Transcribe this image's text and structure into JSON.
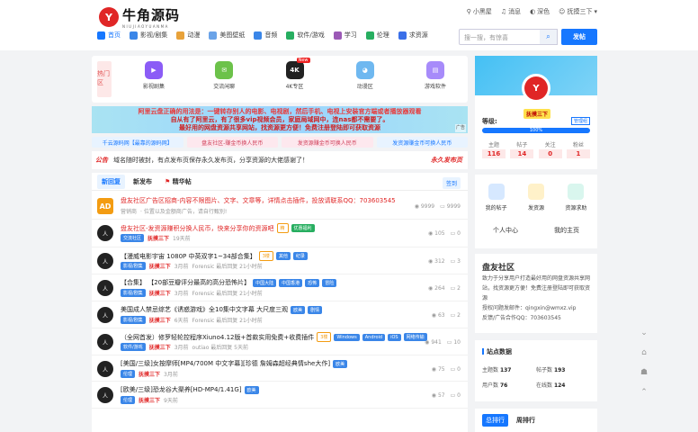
{
  "logo": {
    "mark": "Y",
    "name": "牛角源码",
    "sub": "NIUJIAOYUANMA"
  },
  "top_right": {
    "user1": "小黑屋",
    "messages": "消息",
    "theme": "深色",
    "user2": "抚摸三下"
  },
  "nav": [
    {
      "label": "首页",
      "color": "#1677ff"
    },
    {
      "label": "影视/剧集",
      "color": "#3a86e8"
    },
    {
      "label": "动漫",
      "color": "#e8a23a"
    },
    {
      "label": "美图壁纸",
      "color": "#6aa3e8"
    },
    {
      "label": "音频",
      "color": "#3a86e8"
    },
    {
      "label": "软件/游戏",
      "color": "#27ae60"
    },
    {
      "label": "学习",
      "color": "#9b59b6"
    },
    {
      "label": "伦理",
      "color": "#27ae60"
    },
    {
      "label": "求资源",
      "color": "#3a6fe8"
    }
  ],
  "search": {
    "placeholder": "搜一搜，有惊喜",
    "button": "⌕"
  },
  "post_button": "发帖",
  "hot": {
    "tag": "热门区",
    "items": [
      {
        "label": "影视剧集",
        "icon": "▶",
        "color": "#8b5cf6"
      },
      {
        "label": "交流闲聊",
        "icon": "✉",
        "color": "#6cc24a"
      },
      {
        "label": "4K专区",
        "icon": "4K",
        "color": "#222222",
        "badge": "New"
      },
      {
        "label": "动漫区",
        "icon": "◕",
        "color": "#6fb8f0"
      },
      {
        "label": "游戏软件",
        "icon": "▤",
        "color": "#a78bfa"
      }
    ]
  },
  "ad_banner": {
    "line1": "阿里云盘正确的用法是：一键转存别人的电影、电视剧，然后手机、电视上安装官方端或者播放器观看",
    "line2": "自从有了阿里云，有了很多vip视频会员，家庭局域网中，连nas都不需要了。",
    "line3": "最好用的网盘资源共享网站，找资源更方便！免费注册登陆即可获取资源",
    "label": "广告"
  },
  "links": [
    "千云源码网【最靠的源码网】",
    "盘友社区-赚金币换人民币",
    "发资源赚金币可换人民币",
    "发资源赚金币可换人民币"
  ],
  "notice": {
    "tag": "公告",
    "text": "域名随时被封，有点发布页保存永久发布页，分享资源的大佬感谢了！",
    "right": "永久发布页"
  },
  "tabs": [
    "新回复",
    "新发布",
    "精华帖"
  ],
  "sign": "签到",
  "posts": [
    {
      "avatar": "AD",
      "title": "盘友社区广告区招商-内容不限图片、文字、文章等，详情点击插件，投放请联系QQ：703603545",
      "meta_user": "营销商",
      "meta_text": "· 位置以及金额商广告，请自行甄别!",
      "views": "9999",
      "comments": "9999",
      "red": true
    },
    {
      "avatar": "人",
      "title": "盘友社区-发资源赚积分换人民币，快来分享你的资源吧",
      "chips": [
        {
          "t": "精",
          "k": "o"
        },
        {
          "t": "优惠福利",
          "k": "g"
        }
      ],
      "cat": "交流社区",
      "user": "抚摸三下",
      "time": "19天前",
      "views": "105",
      "comments": "0",
      "red": true
    },
    {
      "avatar": "人",
      "title": "【漫威电影宇宙 1080P 中英双字1~34部合集】",
      "chips": [
        {
          "t": "3楼",
          "k": "o"
        },
        {
          "t": "其他",
          "k": ""
        },
        {
          "t": "纪录",
          "k": ""
        }
      ],
      "cat": "影视/剧集",
      "user": "抚摸三下",
      "time": "3月前",
      "reply": "Forensic 最后回复 21小时前",
      "views": "312",
      "comments": "3"
    },
    {
      "avatar": "人",
      "title": "【合集】 【20部豆瓣评分最高的高分恐怖片】",
      "chips": [
        {
          "t": "中国大陆",
          "k": ""
        },
        {
          "t": "中国香港",
          "k": ""
        },
        {
          "t": "恐怖",
          "k": ""
        },
        {
          "t": "冒险",
          "k": ""
        }
      ],
      "cat": "影视/剧集",
      "user": "抚摸三下",
      "time": "3月前",
      "reply": "Forensic 最后回复 21小时前",
      "views": "264",
      "comments": "2"
    },
    {
      "avatar": "人",
      "title": "美国成人禁忌综艺《诱惑游戏》全10集中文字幕 大尺度三观",
      "chips": [
        {
          "t": "欧美",
          "k": ""
        },
        {
          "t": "剧情",
          "k": ""
        }
      ],
      "cat": "影视/剧集",
      "user": "抚摸三下",
      "time": "6天前",
      "reply": "Forensic 最后回复 21小时前",
      "views": "63",
      "comments": "2"
    },
    {
      "avatar": "人",
      "title": "（全网首发）修罗轻轮控程序Xiuno4.12版+首款实用免费+收费插件",
      "chips": [
        {
          "t": "3楼",
          "k": "o"
        },
        {
          "t": "Windows",
          "k": ""
        },
        {
          "t": "Android",
          "k": ""
        },
        {
          "t": "iOS",
          "k": ""
        },
        {
          "t": "网络传输",
          "k": ""
        }
      ],
      "cat": "软件/游戏",
      "user": "抚摸三下",
      "time": "3月前",
      "reply": "outiao 最后回复 5天前",
      "views": "941",
      "comments": "10"
    },
    {
      "avatar": "人",
      "title": "[美国/三级]女按摩师[MP4/700M 中文字幕][珍德 詹姆森超经典情she大作]",
      "chips": [
        {
          "t": "欧美",
          "k": ""
        }
      ],
      "cat": "伦理",
      "user": "抚摸三下",
      "time": "3月前",
      "views": "75",
      "comments": "0"
    },
    {
      "avatar": "人",
      "title": "[欧美/三级]恐龙谷大渠养[HD-MP4/1.41G]",
      "chips": [
        {
          "t": "欧美",
          "k": ""
        }
      ],
      "cat": "伦理",
      "user": "抚摸三下",
      "time": "9天前",
      "views": "57",
      "comments": "0"
    }
  ],
  "profile": {
    "name": "抚摸三下",
    "level_label": "等级:",
    "admin": "管理组",
    "progress": "100%",
    "progress_value": 100,
    "stats": [
      {
        "k": "主题",
        "v": "116"
      },
      {
        "k": "帖子",
        "v": "14"
      },
      {
        "k": "关注",
        "v": "0"
      },
      {
        "k": "粉丝",
        "v": "1"
      }
    ]
  },
  "quick": [
    {
      "label": "我的帖子",
      "color": "#d6e8ff"
    },
    {
      "label": "发资源",
      "color": "#fff1c9"
    },
    {
      "label": "资源求助",
      "color": "#d9f6ee"
    }
  ],
  "twobtn": [
    "个人中心",
    "我的主页"
  ],
  "about": {
    "title": "盘友社区",
    "lines": [
      "致力于分享用户打造最好用的网盘资源共享网",
      "站，找资源更方便！免费注册登陆即可获取资源",
      "授权问题发邮件：qingxin@wmxz.vip",
      "反馈/广告合作QQ：703603545"
    ]
  },
  "site": {
    "title": "站点数据",
    "items": [
      {
        "k": "主题数",
        "v": "137"
      },
      {
        "k": "帖子数",
        "v": "193"
      },
      {
        "k": "用户数",
        "v": "76"
      },
      {
        "k": "在线数",
        "v": "124"
      }
    ]
  },
  "rank": [
    "总排行",
    "周排行"
  ],
  "float": [
    "⌄",
    "⌂",
    "☗",
    "⌃"
  ]
}
